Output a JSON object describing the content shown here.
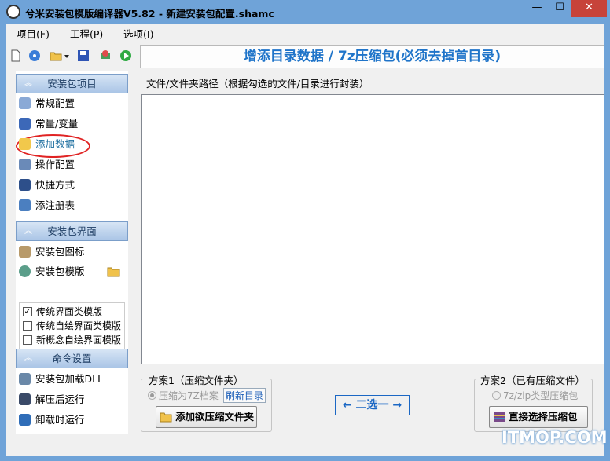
{
  "window": {
    "title": "兮米安装包模版编译器V5.82 - 新建安装包配置.shamc",
    "min_label": "—",
    "max_label": "☐",
    "close_label": "✕"
  },
  "menubar": [
    "项目(F)",
    "工程(P)",
    "选项(I)"
  ],
  "toolbar": [
    "new-file-icon",
    "disc-icon",
    "open-folder-icon",
    "dropdown-arrow-icon",
    "save-icon",
    "build-icon",
    "run-icon"
  ],
  "header": {
    "title": "增添目录数据 / 7z压缩包(必须去掉首目录)"
  },
  "sidebar": {
    "section1": {
      "label": "安装包项目",
      "items": [
        "常规配置",
        "常量/变量",
        "添加数据",
        "操作配置",
        "快捷方式",
        "添注册表"
      ]
    },
    "section2": {
      "label": "安装包界面",
      "items": [
        "安装包图标"
      ],
      "template_label": "安装包模版",
      "templates": [
        {
          "label": "传统界面类模版",
          "checked": true
        },
        {
          "label": "传统自绘界面类模版",
          "checked": false
        },
        {
          "label": "新概念自绘界面模版",
          "checked": false
        }
      ]
    },
    "section3": {
      "label": "命令设置",
      "items": [
        "安装包加载DLL",
        "解压后运行",
        "卸载时运行"
      ]
    }
  },
  "main": {
    "path_label": "文件/文件夹路径（根据勾选的文件/目录进行封装）"
  },
  "plan1": {
    "title": "方案1（压缩文件夹）",
    "radio_label": "压缩为7Z档案",
    "refresh_label": "刷新目录",
    "button_label": "添加欲压缩文件夹"
  },
  "choose_one_label": "← 二选一 →",
  "plan2": {
    "title": "方案2（已有压缩文件）",
    "radio_label": "7z/zip类型压缩包",
    "button_label": "直接选择压缩包"
  },
  "watermark": "ITMOP.COM",
  "colors": {
    "title_blue": "#1f74c9",
    "highlight_red": "#e02323",
    "titlebar": "#6fa3d8"
  }
}
